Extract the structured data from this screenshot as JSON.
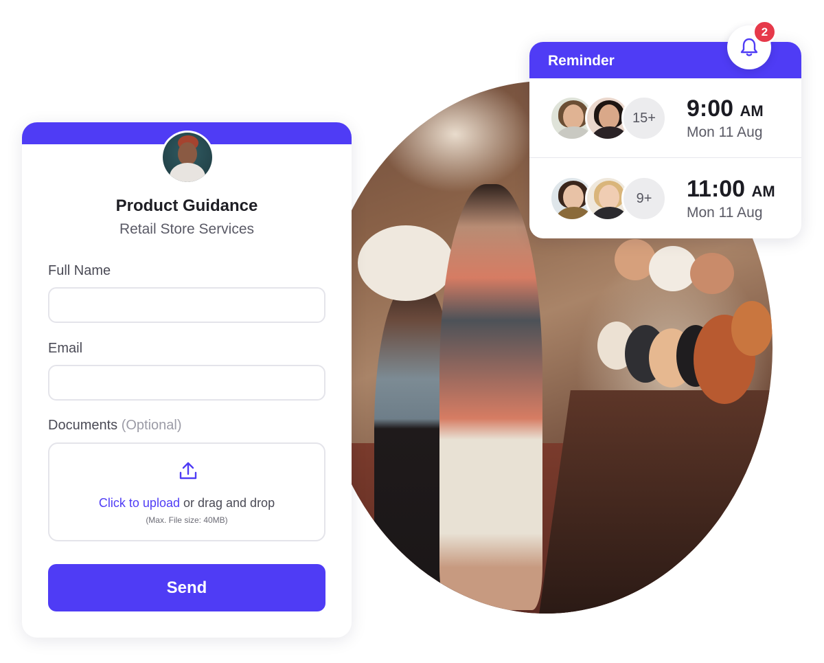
{
  "form": {
    "title": "Product Guidance",
    "subtitle": "Retail Store Services",
    "full_name_label": "Full Name",
    "full_name_value": "",
    "email_label": "Email",
    "email_value": "",
    "documents_label": "Documents",
    "documents_optional": "(Optional)",
    "upload_link": "Click to upload",
    "upload_rest": " or drag and drop",
    "upload_hint": "(Max. File size: 40MB)",
    "send_label": "Send"
  },
  "reminder": {
    "title": "Reminder",
    "notification_count": "2",
    "items": [
      {
        "count": "15+",
        "time": "9:00",
        "ampm": "AM",
        "date": "Mon 11 Aug"
      },
      {
        "count": "9+",
        "time": "11:00",
        "ampm": "AM",
        "date": "Mon 11 Aug"
      }
    ]
  },
  "colors": {
    "brand": "#4f3cf5",
    "badge": "#e6394a"
  },
  "icons": [
    "upload-icon",
    "bell-icon"
  ]
}
